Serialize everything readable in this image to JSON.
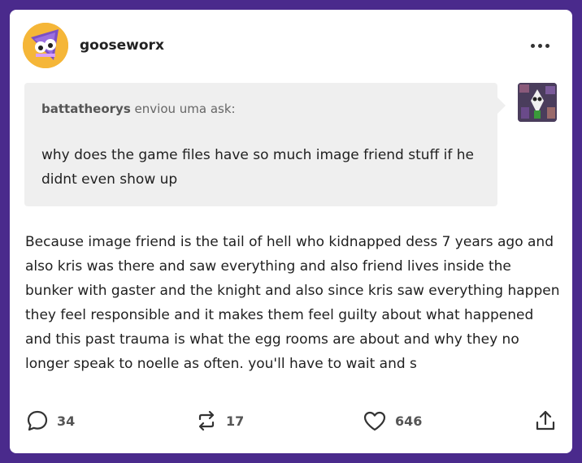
{
  "post": {
    "username": "gooseworx",
    "more_icon": "ellipsis-icon"
  },
  "ask": {
    "asker": "battatheorys",
    "sent_text": "enviou uma ask:",
    "question": "why does the game files have so much image friend stuff if he didnt even show up"
  },
  "answer": {
    "text": "Because image friend is the tail of hell who kidnapped dess 7 years ago and also kris was there and saw everything and also friend lives inside the bunker with gaster and the knight and also since kris saw everything happen they feel responsible and it makes them feel guilty about what happened and this past trauma is what the egg rooms are about and why they no longer speak to noelle as often. you'll have to wait and s"
  },
  "footer": {
    "replies": "34",
    "reblogs": "17",
    "likes": "646"
  },
  "colors": {
    "background": "#4a2a8c",
    "card": "#ffffff",
    "ask_box": "#efefef",
    "avatar": "#f5b638"
  }
}
